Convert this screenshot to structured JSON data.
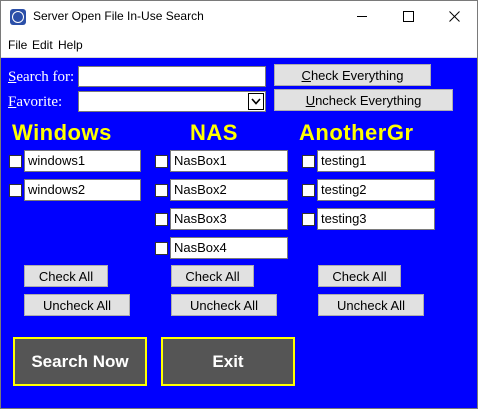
{
  "window": {
    "title": "Server Open File In-Use Search",
    "icon": "app-icon"
  },
  "menu": {
    "file": "File",
    "edit": "Edit",
    "help": "Help"
  },
  "search": {
    "label_first": "S",
    "label_rest": "earch for:",
    "value": ""
  },
  "favorite": {
    "label_first": "F",
    "label_rest": "avorite:",
    "selected": ""
  },
  "global_buttons": {
    "check_first": "C",
    "check_rest": "heck Everything",
    "uncheck_first": "U",
    "uncheck_rest": "ncheck Everything"
  },
  "groups": [
    {
      "title": "Windows",
      "hosts": [
        "windows1",
        "windows2"
      ],
      "check_all": "Check All",
      "uncheck_all": "Uncheck All"
    },
    {
      "title": "NAS",
      "hosts": [
        "NasBox1",
        "NasBox2",
        "NasBox3",
        "NasBox4"
      ],
      "check_all": "Check All",
      "uncheck_all": "Uncheck All"
    },
    {
      "title": "AnotherGr",
      "hosts": [
        "testing1",
        "testing2",
        "testing3"
      ],
      "check_all": "Check All",
      "uncheck_all": "Uncheck All"
    }
  ],
  "actions": {
    "search_now": "Search Now",
    "exit": "Exit"
  },
  "colors": {
    "background": "#0000ff",
    "group_title": "#ffff00",
    "action_button": "#555555",
    "action_border": "#ffff00"
  }
}
